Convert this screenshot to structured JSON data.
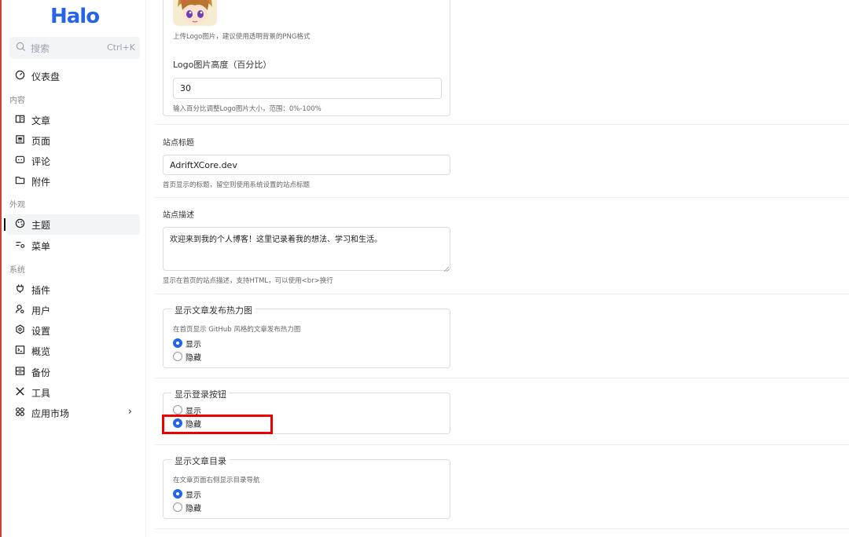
{
  "app": {
    "logo": "Halo"
  },
  "search": {
    "placeholder": "搜索",
    "shortcut": "Ctrl+K"
  },
  "sidebar": {
    "dashboard": "仪表盘",
    "groups": {
      "content": "内容",
      "appearance": "外观",
      "system": "系统"
    },
    "items": {
      "posts": "文章",
      "pages": "页面",
      "comments": "评论",
      "attachments": "附件",
      "themes": "主题",
      "menus": "菜单",
      "plugins": "插件",
      "users": "用户",
      "settings": "设置",
      "overview": "概览",
      "backup": "备份",
      "tools": "工具",
      "market": "应用市场"
    }
  },
  "form": {
    "logo": {
      "upload_help": "上传Logo图片，建议使用透明背景的PNG格式",
      "height_label": "Logo图片高度（百分比）",
      "height_value": "30",
      "height_help": "输入百分比调整Logo图片大小，范围：0%-100%"
    },
    "site_title": {
      "label": "站点标题",
      "value": "AdriftXCore.dev",
      "help": "首页显示的标题，留空则使用系统设置的站点标题"
    },
    "site_desc": {
      "label": "站点描述",
      "value": "欢迎来到我的个人博客！这里记录着我的想法、学习和生活。",
      "help": "显示在首页的站点描述，支持HTML，可以使用<br>换行"
    },
    "heatmap": {
      "legend": "显示文章发布热力图",
      "help": "在首页显示 GitHub 风格的文章发布热力图",
      "opt_show": "显示",
      "opt_hide": "隐藏",
      "selected": "显示"
    },
    "login_btn": {
      "legend": "显示登录按钮",
      "opt_show": "显示",
      "opt_hide": "隐藏",
      "selected": "隐藏"
    },
    "toc": {
      "legend": "显示文章目录",
      "help": "在文章页面右侧显示目录导航",
      "opt_show": "显示",
      "opt_hide": "隐藏",
      "selected": "显示"
    }
  },
  "colors": {
    "accent": "#2563eb",
    "highlight": "#e00000"
  }
}
